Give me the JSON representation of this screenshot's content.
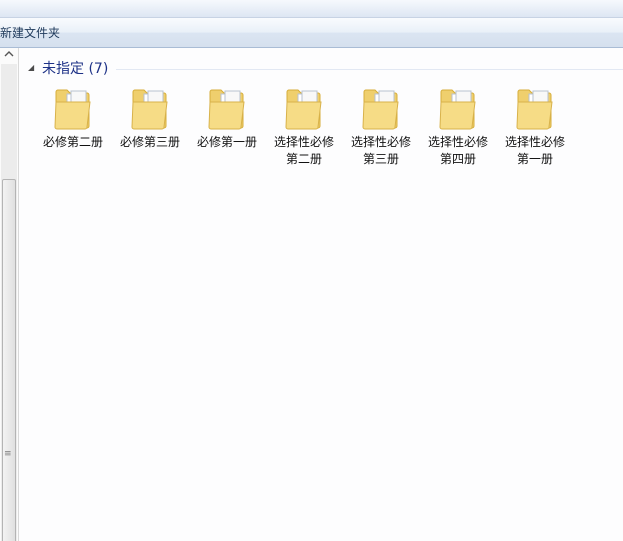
{
  "toolbar": {
    "new_folder_label": "新建文件夹"
  },
  "group": {
    "name": "未指定",
    "count_text": "(7)"
  },
  "files": [
    {
      "line1": "必修第二册",
      "line2": ""
    },
    {
      "line1": "必修第三册",
      "line2": ""
    },
    {
      "line1": "必修第一册",
      "line2": ""
    },
    {
      "line1": "选择性必修",
      "line2": "第二册"
    },
    {
      "line1": "选择性必修",
      "line2": "第三册"
    },
    {
      "line1": "选择性必修",
      "line2": "第四册"
    },
    {
      "line1": "选择性必修",
      "line2": "第一册"
    }
  ],
  "icons": {
    "folder": "folder-icon",
    "scroll_up": "chevron-up-icon",
    "group_toggle": "triangle-down-icon"
  },
  "colors": {
    "group_title": "#1e3287",
    "folder_yellow": "#f2d77c"
  }
}
